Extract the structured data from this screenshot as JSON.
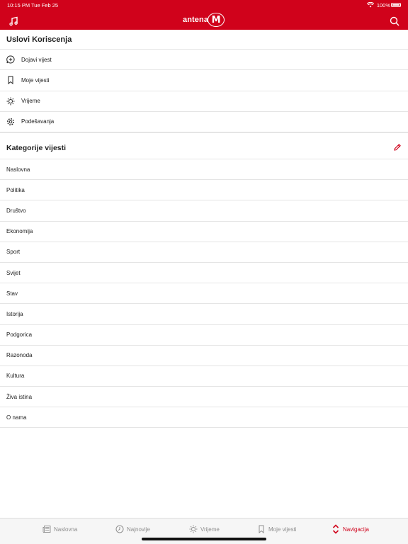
{
  "status_bar": {
    "time": "10:15 PM",
    "date": "Tue Feb 25",
    "battery": "100%"
  },
  "header": {
    "logo_text": "antena",
    "logo_mark": "M",
    "accent": "#d0021b"
  },
  "terms": {
    "title": "Uslovi Koriscenja"
  },
  "menu": [
    {
      "label": "Dojavi vijest",
      "icon": "add-comment-icon"
    },
    {
      "label": "Moje vijesti",
      "icon": "bookmark-icon"
    },
    {
      "label": "Vrijeme",
      "icon": "sun-icon"
    },
    {
      "label": "Podešavanja",
      "icon": "gear-icon"
    }
  ],
  "categories": {
    "title": "Kategorije vijesti",
    "items": [
      "Naslovna",
      "Politika",
      "Društvo",
      "Ekonomija",
      "Sport",
      "Svijet",
      "Stav",
      "Istorija",
      "Podgorica",
      "Razonoda",
      "Kultura",
      "Živa istina",
      "O nama"
    ]
  },
  "tabs": [
    {
      "label": "Naslovna",
      "icon": "newspaper-icon"
    },
    {
      "label": "Najnovije",
      "icon": "clock-icon"
    },
    {
      "label": "Vrijeme",
      "icon": "sun-icon"
    },
    {
      "label": "Moje vijesti",
      "icon": "bookmark-icon"
    },
    {
      "label": "Navigacija",
      "icon": "chevron-up-down-icon",
      "active": true
    }
  ]
}
